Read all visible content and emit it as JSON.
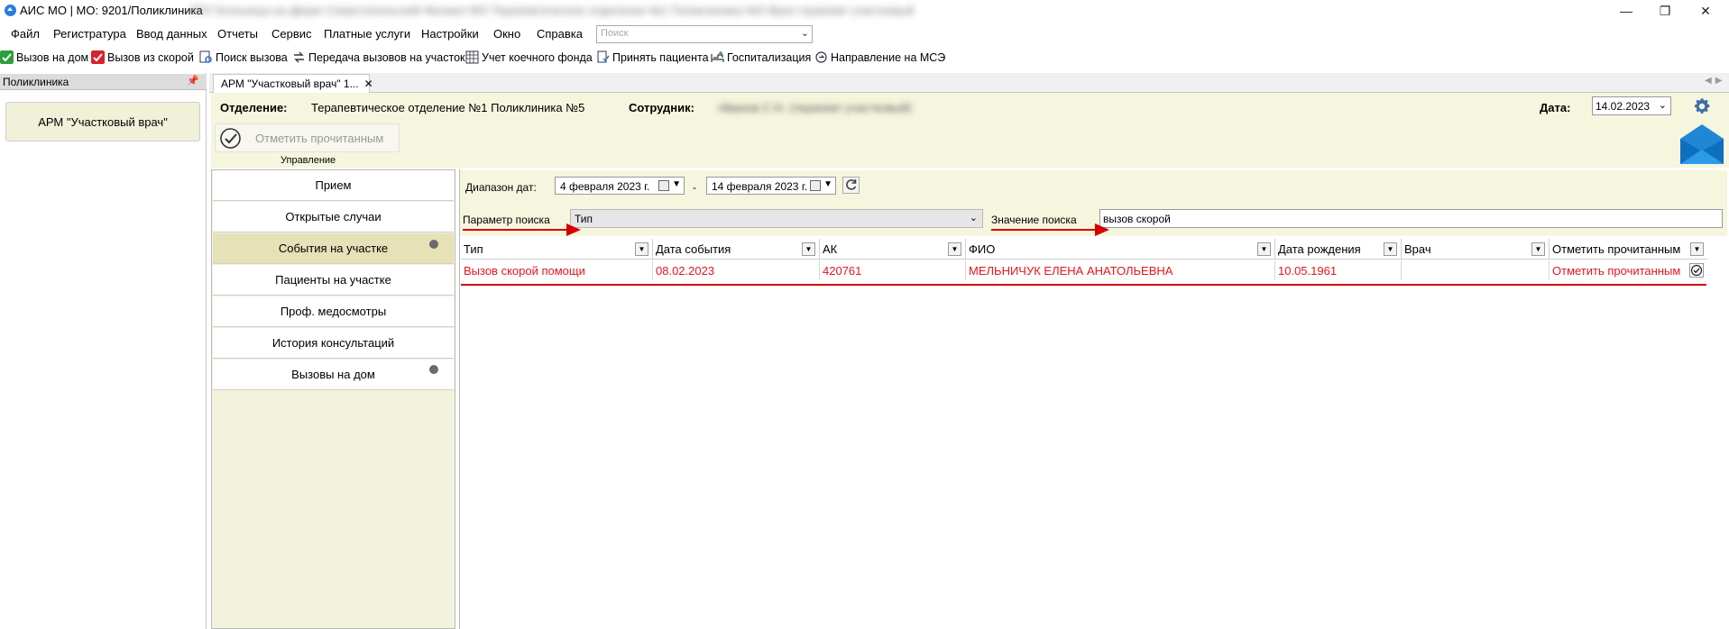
{
  "window": {
    "title": "АИС МО | МО: 9201/Поликлиника",
    "title_blurred": "ЛПУ Больница на Дворе Севастопольский Филиал МО Терапевтическое отделение №1 Поликлиника №5 Врач-терапевт участковый"
  },
  "menu": {
    "items": [
      "Файл",
      "Регистратура",
      "Ввод данных",
      "Отчеты",
      "Сервис",
      "Платные услуги",
      "Настройки",
      "Окно",
      "Справка"
    ],
    "search_placeholder": "Поиск"
  },
  "toolbar": {
    "items": [
      "Вызов на дом",
      "Вызов из скорой",
      "Поиск вызова",
      "Передача вызовов на участок",
      "Учет коечного фонда",
      "Принять пациента",
      "Госпитализация",
      "Направление на МСЭ"
    ]
  },
  "left_panel": {
    "header": "Поликлиника",
    "pin_icon": "pin-icon",
    "arm_button": "АРМ \"Участковый врач\""
  },
  "tabs": {
    "active_tab": "АРМ \"Участковый врач\" 1..."
  },
  "info": {
    "department_label": "Отделение:",
    "department_value": "Терапевтическое отделение №1 Поликлиника №5",
    "employee_label": "Сотрудник:",
    "employee_value": "Иванов С.Н. (терапевт участковый)",
    "date_label": "Дата:",
    "date_value": "14.02.2023",
    "mark_read_button": "Отметить прочитанным",
    "group_label": "Управление"
  },
  "nav": {
    "items": [
      "Прием",
      "Открытые случаи",
      "События на участке",
      "Пациенты на участке",
      "Проф. медосмотры",
      "История консультаций",
      "Вызовы на дом"
    ],
    "active_index": 2
  },
  "filter": {
    "date_range_label": "Диапазон дат:",
    "date_from": "4 февраля  2023 г.",
    "date_separator": "-",
    "date_to": "14 февраля  2023 г.",
    "param_label": "Параметр поиска",
    "param_value": "Тип",
    "value_label": "Значение поиска",
    "value_text": "вызов скорой"
  },
  "grid": {
    "columns": [
      "Тип",
      "Дата события",
      "АК",
      "ФИО",
      "Дата рождения",
      "Врач",
      "Отметить прочитанным"
    ],
    "rows": [
      [
        "Вызов скорой помощи",
        "08.02.2023",
        "420761",
        "МЕЛЬНИЧУК ЕЛЕНА АНАТОЛЬЕВНА",
        "10.05.1961",
        "",
        "Отметить прочитанным"
      ]
    ]
  },
  "colors": {
    "accent_red": "#e8141f",
    "panel_yellow": "#f6f5de",
    "nav_active": "#e6e1b7"
  }
}
